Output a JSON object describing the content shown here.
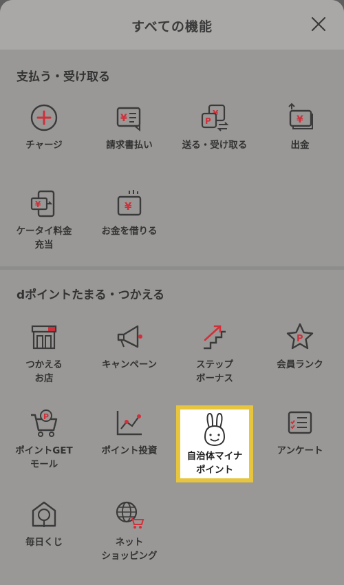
{
  "header": {
    "title": "すべての機能",
    "close_icon": "close-icon"
  },
  "sections": [
    {
      "title": "支払う・受け取る",
      "items": [
        {
          "label": "チャージ",
          "icon": "charge-plus-icon"
        },
        {
          "label": "請求書払い",
          "icon": "invoice-icon"
        },
        {
          "label": "送る・受け取る",
          "icon": "send-receive-icon"
        },
        {
          "label": "出金",
          "icon": "withdraw-icon"
        },
        {
          "label": "ケータイ料金\n充当",
          "icon": "phone-bill-icon"
        },
        {
          "label": "お金を借りる",
          "icon": "borrow-money-icon"
        }
      ]
    },
    {
      "title": "dポイントたまる・つかえる",
      "items": [
        {
          "label": "つかえる\nお店",
          "icon": "store-icon"
        },
        {
          "label": "キャンペーン",
          "icon": "megaphone-icon"
        },
        {
          "label": "ステップ\nボーナス",
          "icon": "step-bonus-icon"
        },
        {
          "label": "会員ランク",
          "icon": "rank-star-icon"
        },
        {
          "label": "ポイントGET\nモール",
          "icon": "point-mall-cart-icon"
        },
        {
          "label": "ポイント投資",
          "icon": "point-invest-chart-icon"
        },
        {
          "label": "自治体マイナ\nポイント",
          "icon": "rabbit-icon",
          "highlighted": true
        },
        {
          "label": "アンケート",
          "icon": "survey-icon"
        },
        {
          "label": "毎日くじ",
          "icon": "daily-lottery-icon"
        },
        {
          "label": "ネット\nショッピング",
          "icon": "net-shopping-icon"
        }
      ]
    }
  ],
  "colors": {
    "accent_red": "#d0303a",
    "highlight_border": "#e7c53d",
    "icon_stroke": "#3a3a3a"
  }
}
